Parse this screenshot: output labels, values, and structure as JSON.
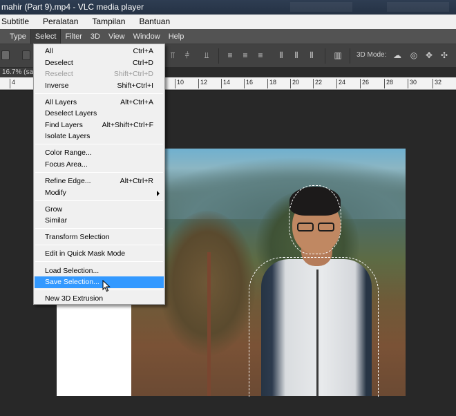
{
  "window": {
    "title": "mahir (Part 9).mp4 - VLC media player"
  },
  "vlc_menu": [
    "Subtitle",
    "Peralatan",
    "Tampilan",
    "Bantuan"
  ],
  "ps_menu": [
    "Type",
    "Select",
    "Filter",
    "3D",
    "View",
    "Window",
    "Help"
  ],
  "ps_menu_active": "Select",
  "options_bar": {
    "mode_label": "3D Mode:"
  },
  "document": {
    "tab_text": "16.7% (sar"
  },
  "ruler": [
    "4",
    "10",
    "12",
    "14",
    "16",
    "18",
    "20",
    "22",
    "24",
    "26",
    "28",
    "30",
    "32"
  ],
  "select_menu": {
    "items": [
      {
        "label": "All",
        "shortcut": "Ctrl+A",
        "state": "normal"
      },
      {
        "label": "Deselect",
        "shortcut": "Ctrl+D",
        "state": "normal"
      },
      {
        "label": "Reselect",
        "shortcut": "Shift+Ctrl+D",
        "state": "disabled"
      },
      {
        "label": "Inverse",
        "shortcut": "Shift+Ctrl+I",
        "state": "normal"
      },
      {
        "label": "All Layers",
        "shortcut": "Alt+Ctrl+A",
        "state": "normal"
      },
      {
        "label": "Deselect Layers",
        "shortcut": "",
        "state": "normal"
      },
      {
        "label": "Find Layers",
        "shortcut": "Alt+Shift+Ctrl+F",
        "state": "normal"
      },
      {
        "label": "Isolate Layers",
        "shortcut": "",
        "state": "normal"
      },
      {
        "label": "Color Range...",
        "shortcut": "",
        "state": "normal"
      },
      {
        "label": "Focus Area...",
        "shortcut": "",
        "state": "normal"
      },
      {
        "label": "Refine Edge...",
        "shortcut": "Alt+Ctrl+R",
        "state": "normal"
      },
      {
        "label": "Modify",
        "shortcut": "",
        "state": "submenu"
      },
      {
        "label": "Grow",
        "shortcut": "",
        "state": "normal"
      },
      {
        "label": "Similar",
        "shortcut": "",
        "state": "normal"
      },
      {
        "label": "Transform Selection",
        "shortcut": "",
        "state": "normal"
      },
      {
        "label": "Edit in Quick Mask Mode",
        "shortcut": "",
        "state": "normal"
      },
      {
        "label": "Load Selection...",
        "shortcut": "",
        "state": "normal"
      },
      {
        "label": "Save Selection...",
        "shortcut": "",
        "state": "highlighted"
      },
      {
        "label": "New 3D Extrusion",
        "shortcut": "",
        "state": "normal"
      }
    ]
  },
  "colors": {
    "highlight": "#3399ff",
    "menu_bg": "#f0f0f0",
    "workspace_bg": "#282828",
    "ps_menubar_bg": "#535353"
  }
}
